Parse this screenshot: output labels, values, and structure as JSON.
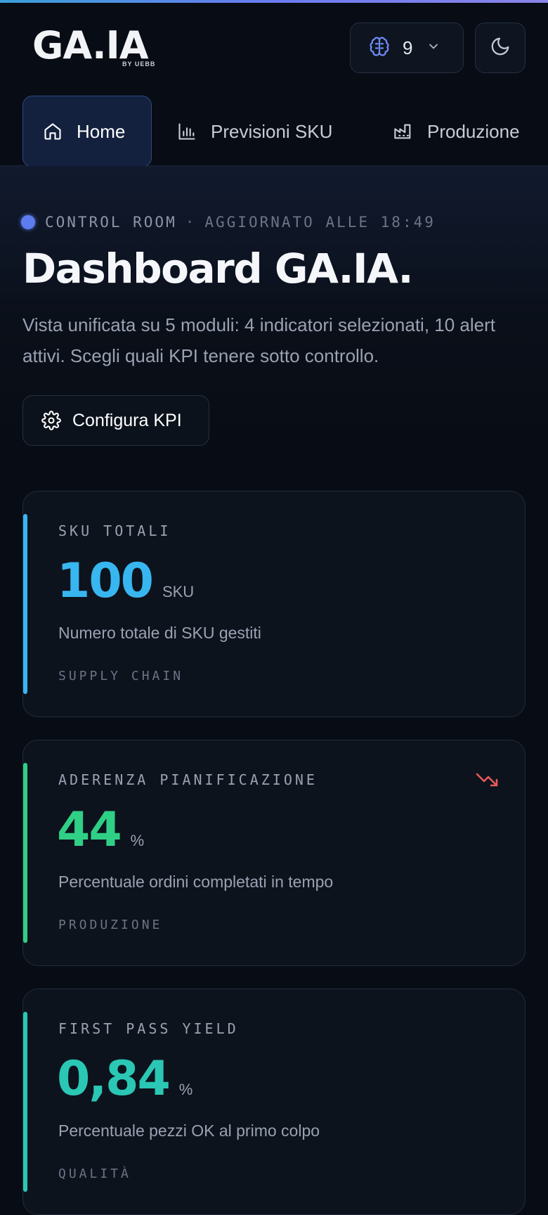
{
  "header": {
    "logo": "GA.IA",
    "logo_sub": "BY UEBB",
    "model_selector": {
      "icon": "brain-icon",
      "count": "9"
    },
    "theme_toggle": {
      "icon": "moon-icon"
    }
  },
  "nav": {
    "tabs": [
      {
        "label": "Home",
        "icon": "home-icon",
        "active": true
      },
      {
        "label": "Previsioni SKU",
        "icon": "bar-chart-icon",
        "active": false
      },
      {
        "label": "Produzione",
        "icon": "factory-icon",
        "active": false
      }
    ]
  },
  "hero": {
    "eyebrow": "CONTROL ROOM",
    "separator": "·",
    "updated": "AGGIORNATO ALLE 18:49",
    "title": "Dashboard GA.IA.",
    "description": "Vista unificata su 5 moduli: 4 indicatori selezionati, 10 alert attivi. Scegli quali KPI tenere sotto controllo.",
    "configure_button": "Configura KPI"
  },
  "kpis": [
    {
      "label": "SKU TOTALI",
      "value": "100",
      "unit": "SKU",
      "description": "Numero totale di SKU gestiti",
      "module": "SUPPLY CHAIN",
      "color": "#38b6f0",
      "trend": null
    },
    {
      "label": "ADERENZA PIANIFICAZIONE",
      "value": "44",
      "unit": "%",
      "description": "Percentuale ordini completati in tempo",
      "module": "PRODUZIONE",
      "color": "#2fcf86",
      "trend": "down"
    },
    {
      "label": "FIRST PASS YIELD",
      "value": "0,84",
      "unit": "%",
      "description": "Percentuale pezzi OK al primo colpo",
      "module": "QUALITÀ",
      "color": "#2ac7b4",
      "trend": null
    }
  ],
  "colors": {
    "accent": "#5d7cf0",
    "trend_down": "#e85a5a",
    "background": "#080c14"
  }
}
